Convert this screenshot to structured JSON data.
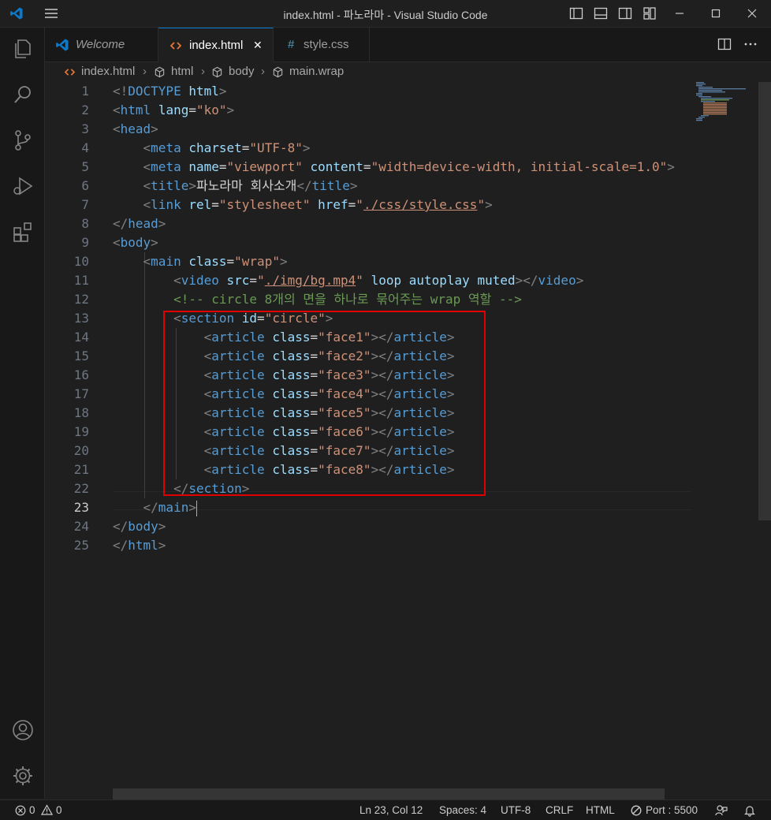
{
  "window": {
    "title": "index.html - 파노라마 - Visual Studio Code"
  },
  "tabs": [
    {
      "label": "Welcome",
      "icon": "vscode-icon"
    },
    {
      "label": "index.html",
      "icon": "html-icon",
      "active": true,
      "close": "✕"
    },
    {
      "label": "style.css",
      "icon": "css-hash-icon"
    }
  ],
  "breadcrumb": [
    "index.html",
    "html",
    "body",
    "main.wrap"
  ],
  "editor": {
    "current_line": 23,
    "line_numbers": [
      "1",
      "2",
      "3",
      "4",
      "5",
      "6",
      "7",
      "8",
      "9",
      "10",
      "11",
      "12",
      "13",
      "14",
      "15",
      "16",
      "17",
      "18",
      "19",
      "20",
      "21",
      "22",
      "23",
      "24",
      "25"
    ],
    "lines": [
      [
        [
          "p",
          "<!"
        ],
        [
          "t",
          "DOCTYPE"
        ],
        [
          "x",
          " "
        ],
        [
          "a",
          "html"
        ],
        [
          "p",
          ">"
        ]
      ],
      [
        [
          "p",
          "<"
        ],
        [
          "t",
          "html"
        ],
        [
          "x",
          " "
        ],
        [
          "a",
          "lang"
        ],
        [
          "x",
          "="
        ],
        [
          "s",
          "\"ko\""
        ],
        [
          "p",
          ">"
        ]
      ],
      [
        [
          "p",
          "<"
        ],
        [
          "t",
          "head"
        ],
        [
          "p",
          ">"
        ]
      ],
      [
        [
          "x",
          "    "
        ],
        [
          "p",
          "<"
        ],
        [
          "t",
          "meta"
        ],
        [
          "x",
          " "
        ],
        [
          "a",
          "charset"
        ],
        [
          "x",
          "="
        ],
        [
          "s",
          "\"UTF-8\""
        ],
        [
          "p",
          ">"
        ]
      ],
      [
        [
          "x",
          "    "
        ],
        [
          "p",
          "<"
        ],
        [
          "t",
          "meta"
        ],
        [
          "x",
          " "
        ],
        [
          "a",
          "name"
        ],
        [
          "x",
          "="
        ],
        [
          "s",
          "\"viewport\""
        ],
        [
          "x",
          " "
        ],
        [
          "a",
          "content"
        ],
        [
          "x",
          "="
        ],
        [
          "s",
          "\"width=device-width, initial-scale=1.0\""
        ],
        [
          "p",
          ">"
        ]
      ],
      [
        [
          "x",
          "    "
        ],
        [
          "p",
          "<"
        ],
        [
          "t",
          "title"
        ],
        [
          "p",
          ">"
        ],
        [
          "x",
          "파노라마 회사소개"
        ],
        [
          "p",
          "</"
        ],
        [
          "t",
          "title"
        ],
        [
          "p",
          ">"
        ]
      ],
      [
        [
          "x",
          "    "
        ],
        [
          "p",
          "<"
        ],
        [
          "t",
          "link"
        ],
        [
          "x",
          " "
        ],
        [
          "a",
          "rel"
        ],
        [
          "x",
          "="
        ],
        [
          "s",
          "\"stylesheet\""
        ],
        [
          "x",
          " "
        ],
        [
          "a",
          "href"
        ],
        [
          "x",
          "="
        ],
        [
          "s",
          "\""
        ],
        [
          "su",
          "./css/style.css"
        ],
        [
          "s",
          "\""
        ],
        [
          "p",
          ">"
        ]
      ],
      [
        [
          "p",
          "</"
        ],
        [
          "t",
          "head"
        ],
        [
          "p",
          ">"
        ]
      ],
      [
        [
          "p",
          "<"
        ],
        [
          "t",
          "body"
        ],
        [
          "p",
          ">"
        ]
      ],
      [
        [
          "x",
          "    "
        ],
        [
          "p",
          "<"
        ],
        [
          "t",
          "main"
        ],
        [
          "x",
          " "
        ],
        [
          "a",
          "class"
        ],
        [
          "x",
          "="
        ],
        [
          "s",
          "\"wrap\""
        ],
        [
          "p",
          ">"
        ]
      ],
      [
        [
          "x",
          "        "
        ],
        [
          "p",
          "<"
        ],
        [
          "t",
          "video"
        ],
        [
          "x",
          " "
        ],
        [
          "a",
          "src"
        ],
        [
          "x",
          "="
        ],
        [
          "s",
          "\""
        ],
        [
          "su",
          "./img/bg.mp4"
        ],
        [
          "s",
          "\""
        ],
        [
          "x",
          " "
        ],
        [
          "a",
          "loop"
        ],
        [
          "x",
          " "
        ],
        [
          "a",
          "autoplay"
        ],
        [
          "x",
          " "
        ],
        [
          "a",
          "muted"
        ],
        [
          "p",
          "></"
        ],
        [
          "t",
          "video"
        ],
        [
          "p",
          ">"
        ]
      ],
      [
        [
          "x",
          "        "
        ],
        [
          "c",
          "<!-- circle 8개의 면을 하나로 묶어주는 wrap 역할 -->"
        ]
      ],
      [
        [
          "x",
          "        "
        ],
        [
          "p",
          "<"
        ],
        [
          "t",
          "section"
        ],
        [
          "x",
          " "
        ],
        [
          "a",
          "id"
        ],
        [
          "x",
          "="
        ],
        [
          "s",
          "\"circle\""
        ],
        [
          "p",
          ">"
        ]
      ],
      [
        [
          "x",
          "            "
        ],
        [
          "p",
          "<"
        ],
        [
          "t",
          "article"
        ],
        [
          "x",
          " "
        ],
        [
          "a",
          "class"
        ],
        [
          "x",
          "="
        ],
        [
          "s",
          "\"face1\""
        ],
        [
          "p",
          "></"
        ],
        [
          "t",
          "article"
        ],
        [
          "p",
          ">"
        ]
      ],
      [
        [
          "x",
          "            "
        ],
        [
          "p",
          "<"
        ],
        [
          "t",
          "article"
        ],
        [
          "x",
          " "
        ],
        [
          "a",
          "class"
        ],
        [
          "x",
          "="
        ],
        [
          "s",
          "\"face2\""
        ],
        [
          "p",
          "></"
        ],
        [
          "t",
          "article"
        ],
        [
          "p",
          ">"
        ]
      ],
      [
        [
          "x",
          "            "
        ],
        [
          "p",
          "<"
        ],
        [
          "t",
          "article"
        ],
        [
          "x",
          " "
        ],
        [
          "a",
          "class"
        ],
        [
          "x",
          "="
        ],
        [
          "s",
          "\"face3\""
        ],
        [
          "p",
          "></"
        ],
        [
          "t",
          "article"
        ],
        [
          "p",
          ">"
        ]
      ],
      [
        [
          "x",
          "            "
        ],
        [
          "p",
          "<"
        ],
        [
          "t",
          "article"
        ],
        [
          "x",
          " "
        ],
        [
          "a",
          "class"
        ],
        [
          "x",
          "="
        ],
        [
          "s",
          "\"face4\""
        ],
        [
          "p",
          "></"
        ],
        [
          "t",
          "article"
        ],
        [
          "p",
          ">"
        ]
      ],
      [
        [
          "x",
          "            "
        ],
        [
          "p",
          "<"
        ],
        [
          "t",
          "article"
        ],
        [
          "x",
          " "
        ],
        [
          "a",
          "class"
        ],
        [
          "x",
          "="
        ],
        [
          "s",
          "\"face5\""
        ],
        [
          "p",
          "></"
        ],
        [
          "t",
          "article"
        ],
        [
          "p",
          ">"
        ]
      ],
      [
        [
          "x",
          "            "
        ],
        [
          "p",
          "<"
        ],
        [
          "t",
          "article"
        ],
        [
          "x",
          " "
        ],
        [
          "a",
          "class"
        ],
        [
          "x",
          "="
        ],
        [
          "s",
          "\"face6\""
        ],
        [
          "p",
          "></"
        ],
        [
          "t",
          "article"
        ],
        [
          "p",
          ">"
        ]
      ],
      [
        [
          "x",
          "            "
        ],
        [
          "p",
          "<"
        ],
        [
          "t",
          "article"
        ],
        [
          "x",
          " "
        ],
        [
          "a",
          "class"
        ],
        [
          "x",
          "="
        ],
        [
          "s",
          "\"face7\""
        ],
        [
          "p",
          "></"
        ],
        [
          "t",
          "article"
        ],
        [
          "p",
          ">"
        ]
      ],
      [
        [
          "x",
          "            "
        ],
        [
          "p",
          "<"
        ],
        [
          "t",
          "article"
        ],
        [
          "x",
          " "
        ],
        [
          "a",
          "class"
        ],
        [
          "x",
          "="
        ],
        [
          "s",
          "\"face8\""
        ],
        [
          "p",
          "></"
        ],
        [
          "t",
          "article"
        ],
        [
          "p",
          ">"
        ]
      ],
      [
        [
          "x",
          "        "
        ],
        [
          "p",
          "</"
        ],
        [
          "t",
          "section"
        ],
        [
          "p",
          ">"
        ]
      ],
      [
        [
          "x",
          "    "
        ],
        [
          "p",
          "</"
        ],
        [
          "t",
          "main"
        ],
        [
          "p",
          ">"
        ]
      ],
      [
        [
          "p",
          "</"
        ],
        [
          "t",
          "body"
        ],
        [
          "p",
          ">"
        ]
      ],
      [
        [
          "p",
          "</"
        ],
        [
          "t",
          "html"
        ],
        [
          "p",
          ">"
        ]
      ]
    ]
  },
  "statusbar": {
    "errors": "0",
    "warnings": "0",
    "position": "Ln 23, Col 12",
    "spaces": "Spaces: 4",
    "encoding": "UTF-8",
    "eol": "CRLF",
    "language": "HTML",
    "port": "Port : 5500"
  },
  "colors": {
    "accent": "#0078d4",
    "highlight_box": "#e00000",
    "tag": "#569cd6",
    "attr": "#9cdcfe",
    "string": "#ce9178",
    "comment": "#6a9955"
  }
}
